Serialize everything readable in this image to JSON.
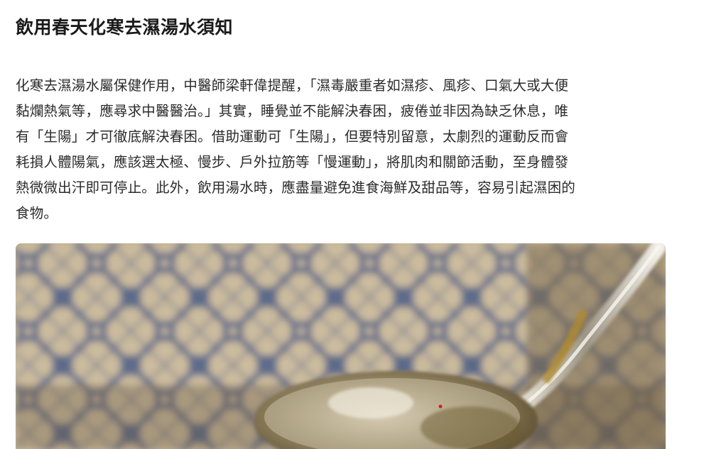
{
  "article": {
    "title": "飲用春天化寒去濕湯水須知",
    "paragraph_lines": [
      "化寒去濕湯水屬保健作用，中醫師梁軒偉提醒，「濕毒嚴重者如濕疹、風疹、口氣大或大便",
      "黏爛熱氣等，應尋求中醫醫治。」其實，睡覺並不能解決春困，疲倦並非因為缺乏休息，唯",
      "有「生陽」才可徹底解決春困。借助運動可「生陽」，但要特別留意，太劇烈的運動反而會",
      "耗損人體陽氣，應該選太極、慢步、戶外拉筋等「慢運動」，將肌肉和關節活動，至身體發",
      "熱微微出汗即可停止。此外，飲用湯水時，應盡量避免進食海鮮及甜品等，容易引起濕困的",
      "食物。"
    ]
  },
  "photo": {
    "subject": "soup ladle over tiled background",
    "colors": {
      "tile_base": "#c9b89c",
      "tile_pattern": "#4a5d86",
      "ladle": "#a89a78",
      "soup": "#6b5a2e"
    }
  }
}
